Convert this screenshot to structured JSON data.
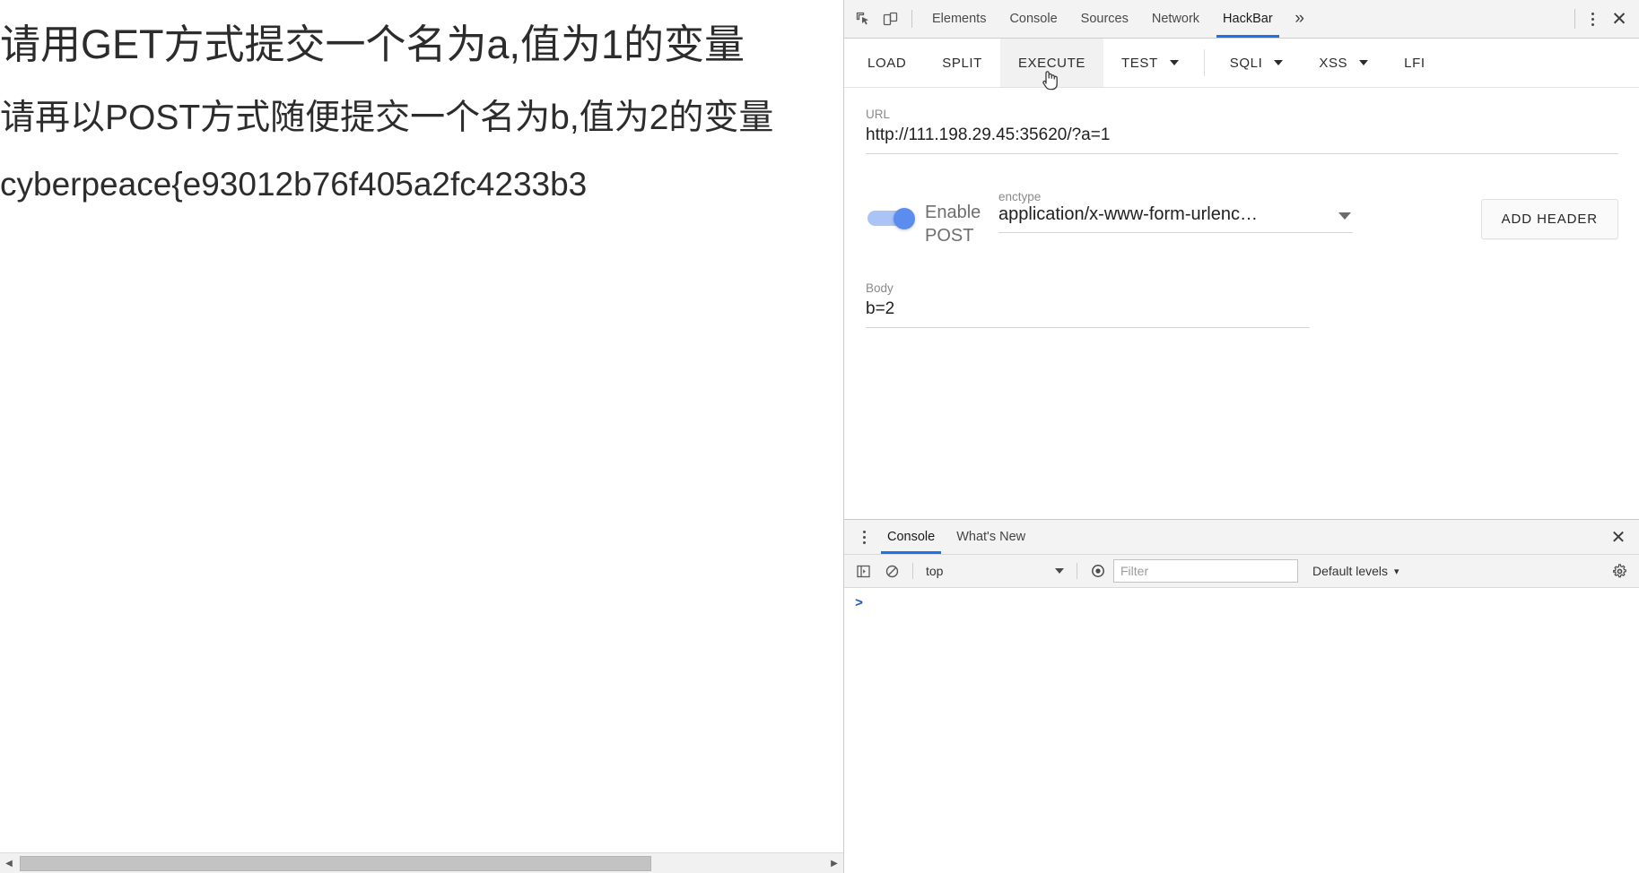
{
  "page": {
    "lines": [
      "请用GET方式提交一个名为a,值为1的变量",
      "请再以POST方式随便提交一个名为b,值为2的变量",
      "cyberpeace{e93012b76f405a2fc4233b3"
    ]
  },
  "devtools": {
    "icons": {
      "inspect": "inspect-element-icon",
      "device": "device-toolbar-icon",
      "more": "»",
      "close": "✕"
    },
    "tabs": [
      {
        "label": "Elements",
        "active": false
      },
      {
        "label": "Console",
        "active": false
      },
      {
        "label": "Sources",
        "active": false
      },
      {
        "label": "Network",
        "active": false
      },
      {
        "label": "HackBar",
        "active": true
      }
    ],
    "accent_color": "#1a73e8"
  },
  "hackbar": {
    "buttons": [
      {
        "label": "LOAD",
        "caret": false,
        "hover": false
      },
      {
        "label": "SPLIT",
        "caret": false,
        "hover": false
      },
      {
        "label": "EXECUTE",
        "caret": false,
        "hover": true
      },
      {
        "label": "TEST",
        "caret": true,
        "hover": false
      },
      {
        "label": "SQLI",
        "caret": true,
        "hover": false
      },
      {
        "label": "XSS",
        "caret": true,
        "hover": false
      },
      {
        "label": "LFI",
        "caret": false,
        "hover": false
      }
    ],
    "url": {
      "label": "URL",
      "value": "http://111.198.29.45:35620/?a=1"
    },
    "post": {
      "toggle_label": "Enable POST",
      "toggle_on": true,
      "toggle_color": "#5b8def",
      "enctype_label": "enctype",
      "enctype_value": "application/x-www-form-urlenc…",
      "add_header_label": "ADD HEADER"
    },
    "body": {
      "label": "Body",
      "value": "b=2"
    }
  },
  "drawer": {
    "tabs": [
      {
        "label": "Console",
        "active": true
      },
      {
        "label": "What's New",
        "active": false
      }
    ],
    "console_toolbar": {
      "context": "top",
      "filter_placeholder": "Filter",
      "levels": "Default levels",
      "levels_caret": "▾"
    },
    "prompt": ">"
  }
}
